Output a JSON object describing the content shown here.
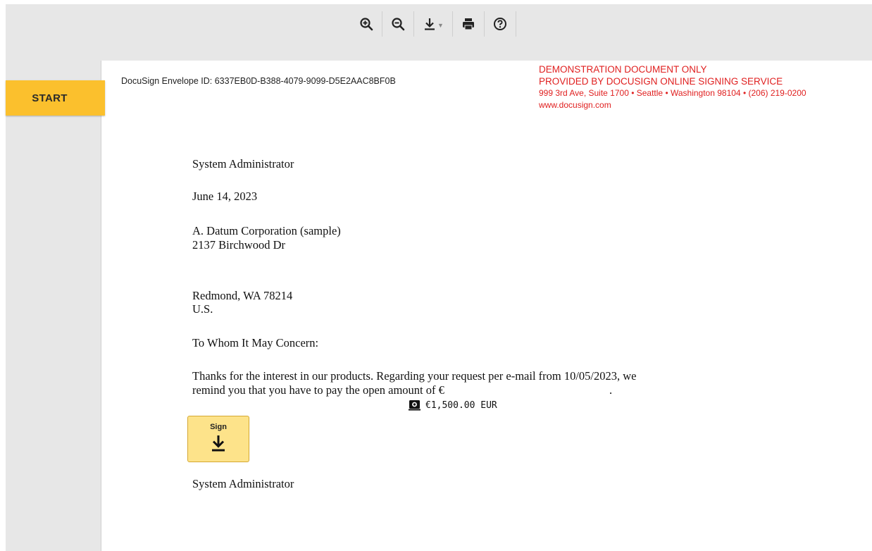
{
  "toolbar": {
    "items": [
      {
        "name": "zoom-in-icon"
      },
      {
        "name": "zoom-out-icon"
      },
      {
        "name": "download-icon"
      },
      {
        "name": "print-icon"
      },
      {
        "name": "help-icon"
      }
    ]
  },
  "start_label": "START",
  "envelope_id": "DocuSign Envelope ID: 6337EB0D-B388-4079-9099-D5E2AAC8BF0B",
  "demo_notice": {
    "line1": "DEMONSTRATION DOCUMENT ONLY",
    "line2": "PROVIDED BY DOCUSIGN ONLINE SIGNING SERVICE",
    "line3": "999 3rd Ave, Suite 1700  • Seattle • Washington 98104 • (206) 219-0200",
    "line4": "www.docusign.com",
    "color": "#e02020"
  },
  "letter": {
    "sender": "System Administrator",
    "date": "June 14, 2023",
    "company": "A. Datum Corporation (sample)",
    "street": "2137 Birchwood Dr",
    "city": "Redmond, WA 78214",
    "country": "U.S.",
    "salutation": "To Whom It May Concern:",
    "body_line1": "Thanks for the interest in our products. Regarding your request per e-mail from 10/05/2023, we",
    "body_line2": "remind you that you have to pay the open amount of €",
    "body_period": ".",
    "signature_name": "System Administrator"
  },
  "amount_field": {
    "value": "€1,500.00 EUR"
  },
  "sign_button": {
    "label": "Sign"
  },
  "colors": {
    "accent": "#fbc02d",
    "sign_bg": "#fde38a"
  }
}
